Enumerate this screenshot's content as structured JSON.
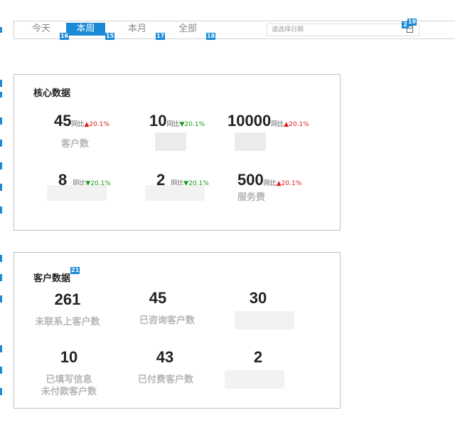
{
  "tabs": [
    {
      "label": "今天",
      "badge": "16"
    },
    {
      "label": "本周",
      "badge": "15"
    },
    {
      "label": "本月",
      "badge": "17"
    },
    {
      "label": "全部",
      "badge": "18"
    }
  ],
  "date_picker": {
    "placeholder": "请选择日期",
    "badge_a": "2",
    "badge_b": "19"
  },
  "core": {
    "title": "核心数据",
    "metrics": [
      {
        "value": "45",
        "compare": "同比",
        "arrow": "▲",
        "pct": "20.1%",
        "trend": "up",
        "label": "客户数"
      },
      {
        "value": "10",
        "compare": "同比",
        "arrow": "▼",
        "pct": "20.1%",
        "trend": "down",
        "label": ""
      },
      {
        "value": "10000",
        "compare": "同比",
        "arrow": "▲",
        "pct": "20.1%",
        "trend": "up",
        "label": ""
      },
      {
        "value": "8",
        "compare": "同比",
        "arrow": "▼",
        "pct": "20.1%",
        "trend": "down",
        "label": ""
      },
      {
        "value": "2",
        "compare": "同比",
        "arrow": "▼",
        "pct": "20.1%",
        "trend": "down",
        "label": ""
      },
      {
        "value": "500",
        "compare": "同比",
        "arrow": "▲",
        "pct": "20.1%",
        "trend": "up",
        "label": "服务费"
      }
    ]
  },
  "customers": {
    "title": "客户数据",
    "badge": "21",
    "items": [
      {
        "value": "261",
        "label": "未联系上客户数"
      },
      {
        "value": "45",
        "label": "已咨询客户数"
      },
      {
        "value": "30",
        "label": ""
      },
      {
        "value": "10",
        "label": "已填写信息\n未付款客户数"
      },
      {
        "value": "43",
        "label": "已付费客户数"
      },
      {
        "value": "2",
        "label": ""
      }
    ]
  },
  "colors": {
    "accent": "#1a8ad8",
    "up": "#e01a1a",
    "down": "#1a9a1a"
  }
}
